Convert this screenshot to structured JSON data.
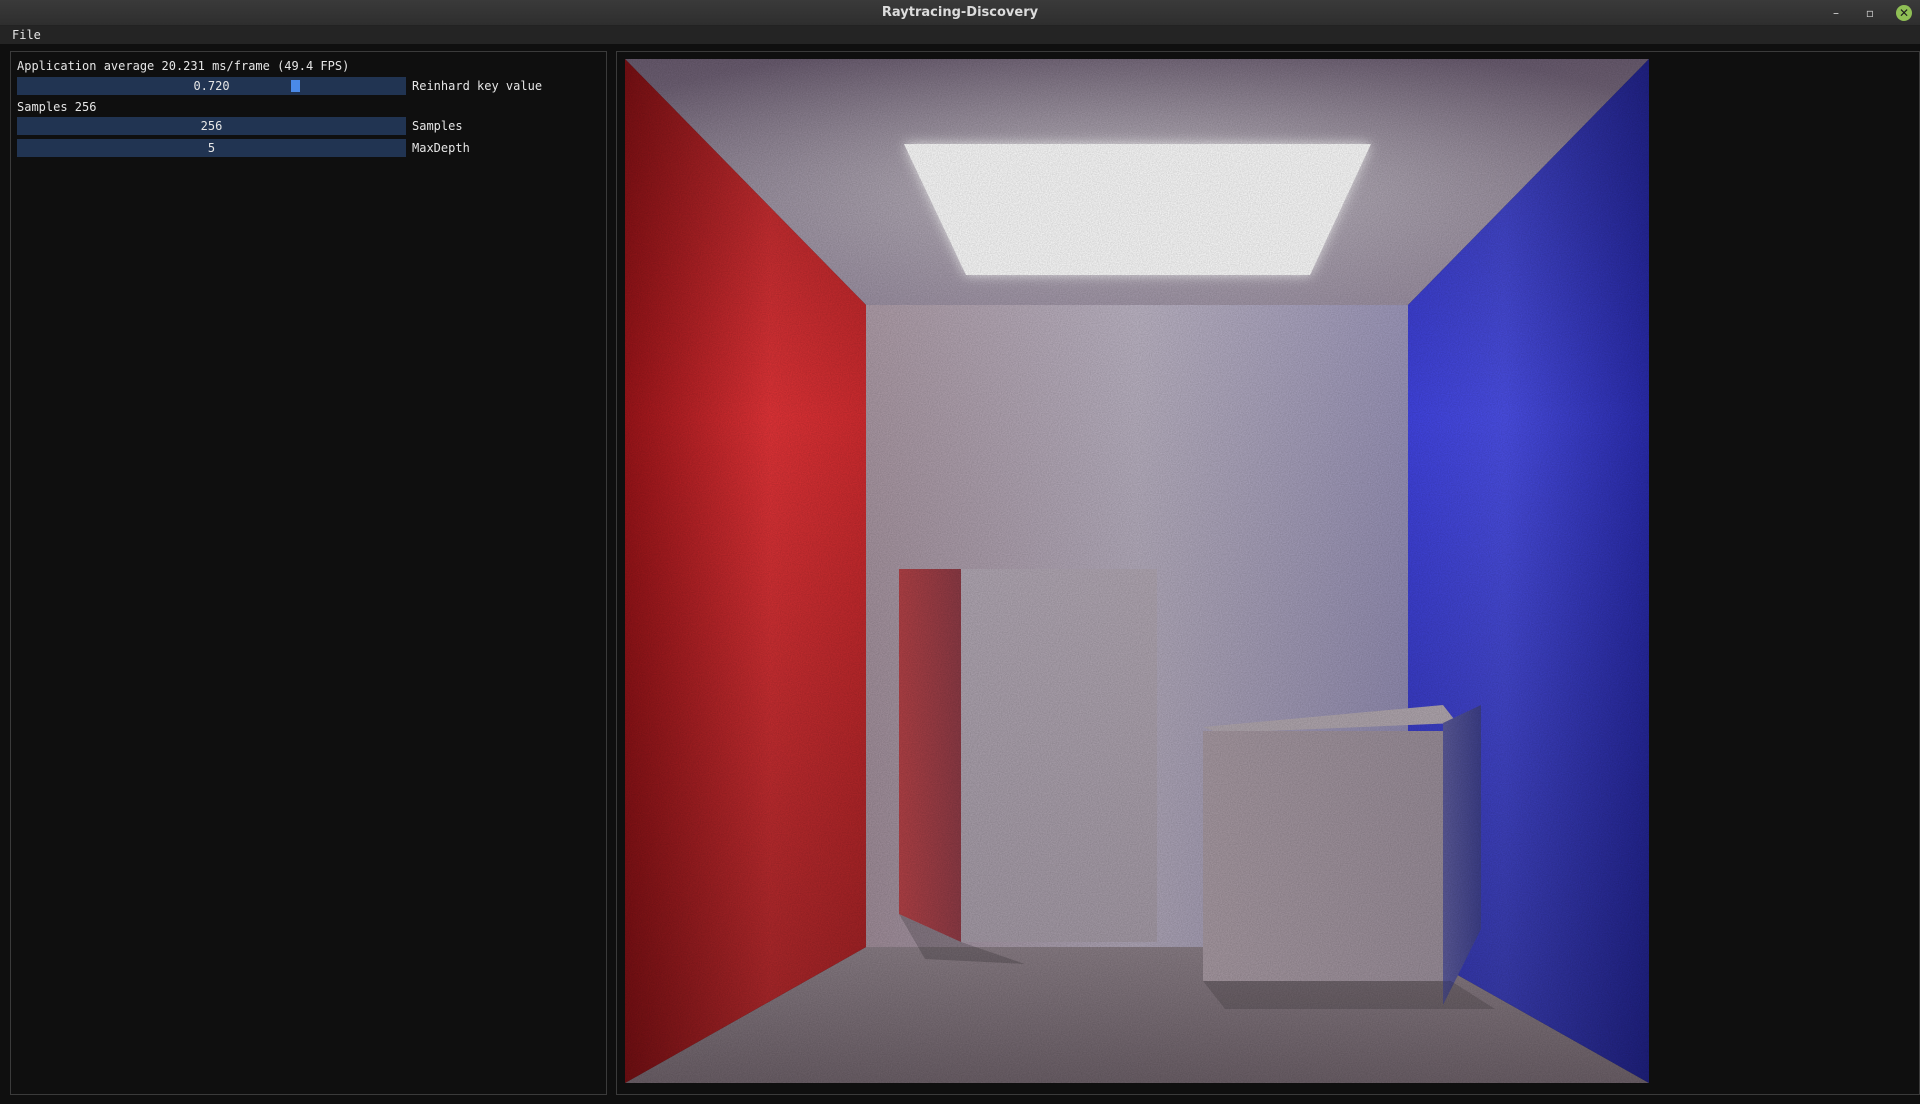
{
  "window": {
    "title": "Raytracing-Discovery",
    "minimize_glyph": "–",
    "restore_glyph": "▫",
    "close_glyph": "✕"
  },
  "menu": {
    "file_label": "File"
  },
  "panel": {
    "stats": "Application average 20.231 ms/frame (49.4 FPS)",
    "reinhard": {
      "value_text": "0.720",
      "label": "Reinhard key value",
      "value_fraction": 0.72
    },
    "samples_text": "Samples 256",
    "samples_slider": {
      "value_text": "256",
      "label": "Samples"
    },
    "maxdepth_slider": {
      "value_text": "5",
      "label": "MaxDepth"
    }
  },
  "colors": {
    "slider_bg": "#213452",
    "slider_grab": "#4a8ae8",
    "left_wall": "#e02a2e",
    "right_wall": "#3c3fe0",
    "light": "#ffffff"
  }
}
